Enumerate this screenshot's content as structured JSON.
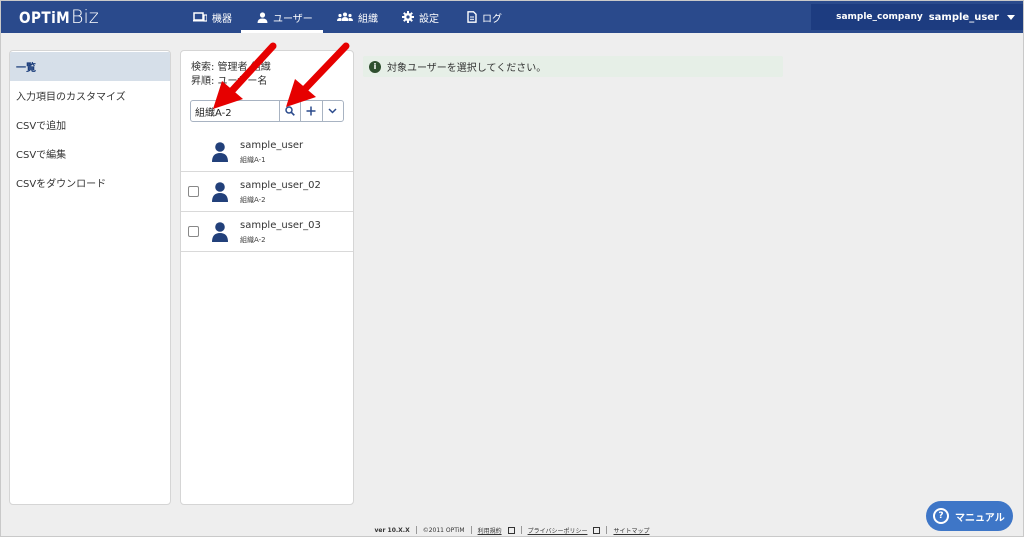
{
  "header": {
    "logo_brand": "OPTiM",
    "logo_product": "Biz",
    "nav": [
      {
        "label": "機器",
        "icon": "device-icon"
      },
      {
        "label": "ユーザー",
        "icon": "user-icon"
      },
      {
        "label": "組織",
        "icon": "organization-icon"
      },
      {
        "label": "設定",
        "icon": "gear-icon"
      },
      {
        "label": "ログ",
        "icon": "document-icon"
      }
    ],
    "active_nav": "ユーザー",
    "company": "sample_company",
    "user": "sample_user"
  },
  "left_menu": {
    "items": [
      "一覧",
      "入力項目のカスタマイズ",
      "CSVで追加",
      "CSVで編集",
      "CSVをダウンロード"
    ],
    "active": "一覧"
  },
  "user_panel": {
    "search_line": "検索: 管理者 組織",
    "sort_line": "昇順: ユーザー名",
    "search_value": "組織A-2",
    "users": [
      {
        "name": "sample_user",
        "org": "組織A-1",
        "has_checkbox": false
      },
      {
        "name": "sample_user_02",
        "org": "組織A-2",
        "has_checkbox": true
      },
      {
        "name": "sample_user_03",
        "org": "組織A-2",
        "has_checkbox": true
      }
    ]
  },
  "info_banner": {
    "icon": "info-icon",
    "text": "対象ユーザーを選択してください。"
  },
  "footer": {
    "version": "ver 10.X.X",
    "copyright": "©2011 OPTiM",
    "links": [
      "利用規約",
      "プライバシーポリシー",
      "サイトマップ"
    ]
  },
  "manual_button": {
    "label": "マニュアル",
    "icon": "question-circle-icon"
  },
  "colors": {
    "header": "#2a4a8c",
    "account_bar": "#1d3c80",
    "active_menu": "#d6dfe9",
    "info_bg": "#e6efe7",
    "manual_button": "#3e76c7",
    "annotation_arrow": "#e60000"
  }
}
